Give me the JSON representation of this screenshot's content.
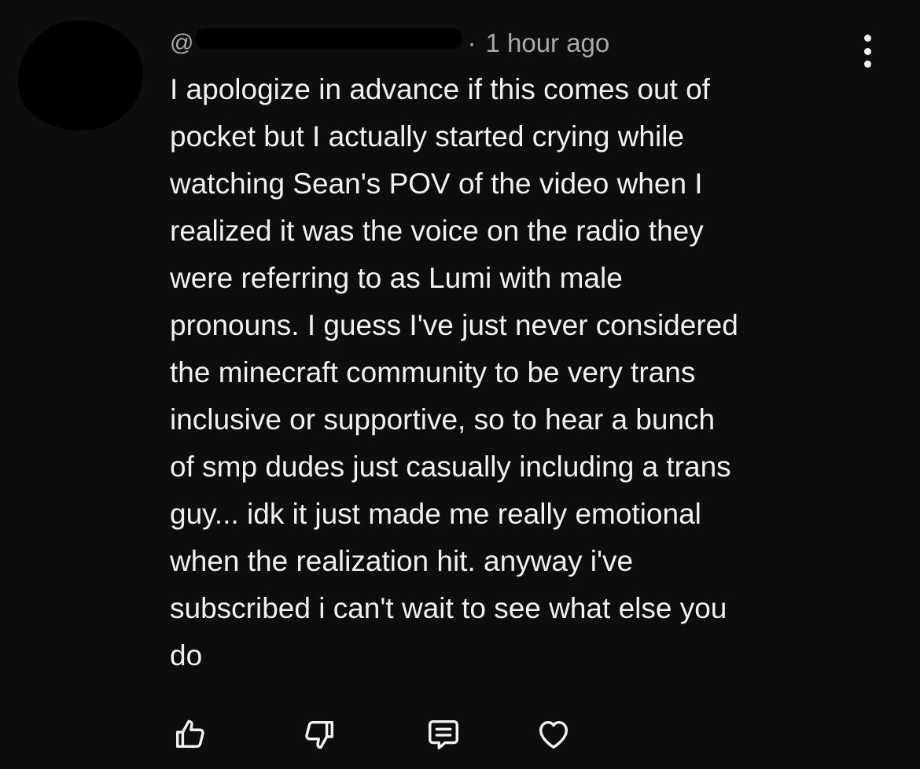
{
  "comment": {
    "handle_prefix": "@",
    "separator": "·",
    "timestamp": "1 hour ago",
    "lines": [
      "I apologize in advance if this comes out of",
      "pocket but I actually started crying while",
      "watching Sean's POV of the video when I",
      "realized it was the voice on the radio they",
      "were referring to as Lumi with male",
      "pronouns. I guess I've just never considered",
      "the minecraft community to be very trans",
      "inclusive or supportive, so to hear a bunch",
      "of smp dudes just casually including a trans",
      "guy... idk it just made me really emotional",
      "when the realization hit. anyway i've",
      "subscribed i can't wait to see what else you",
      "do"
    ]
  },
  "actions": {
    "icons": [
      "thumbs-up-icon",
      "thumbs-down-icon",
      "reply-icon",
      "heart-icon"
    ]
  },
  "colors": {
    "background": "#0d0d0d",
    "text": "#f1f1f1",
    "secondary_text": "#aaaaaa"
  }
}
